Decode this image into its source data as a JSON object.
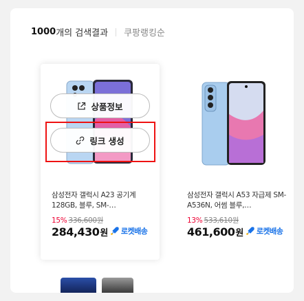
{
  "header": {
    "count_text": "1000",
    "count_suffix": " 개의 검색결과",
    "sort_label": "쿠팡랭킹순"
  },
  "overlay": {
    "product_info_label": "상품정보",
    "link_create_label": "링크 생성"
  },
  "products": [
    {
      "title": "삼성전자 갤럭시 A23 공기계 128GB, 블루, SM-…",
      "discount": "15%",
      "original_price": "336,600원",
      "price": "284,430",
      "currency": "원",
      "delivery": "로켓배송"
    },
    {
      "title": "삼성전자 갤럭시 A53 자급제 SM-A536N, 어썸 블루,…",
      "discount": "13%",
      "original_price": "533,610원",
      "price": "461,600",
      "currency": "원",
      "delivery": "로켓배송"
    }
  ],
  "colors": {
    "accent": "#e11d1d",
    "rocket": "#1a73e8",
    "discount": "#e03"
  }
}
